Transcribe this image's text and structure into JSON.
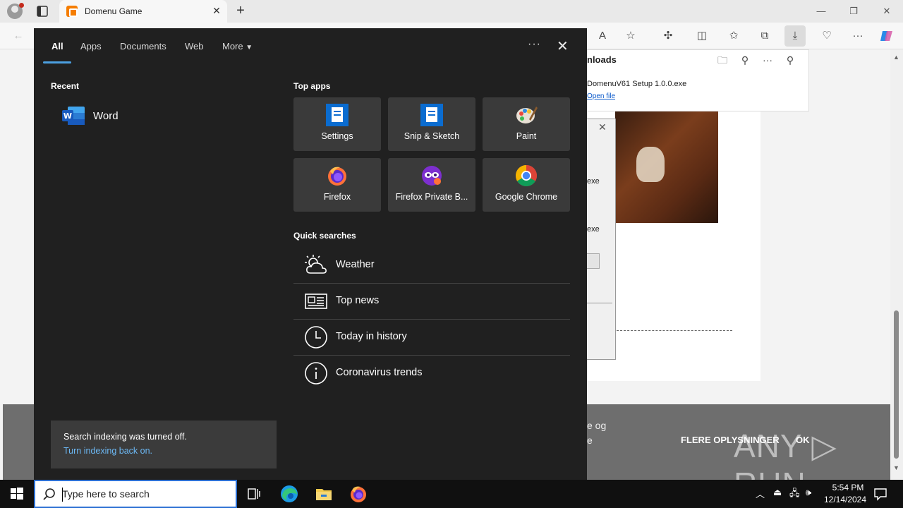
{
  "browser": {
    "tab_title": "Domenu Game",
    "downloads_panel": {
      "title": "nloads",
      "file_name": "DomenuV61 Setup 1.0.0.exe",
      "open_file": "Open file"
    }
  },
  "page": {
    "dialog_text1": "exe",
    "dialog_text2": "exe",
    "cookie_line1": "e og",
    "cookie_line2": "e",
    "cookie_more": "FLERE OPLYSNINGER",
    "cookie_ok": "OK",
    "watermark": "ANY ▷ RUN"
  },
  "search_panel": {
    "tabs": [
      {
        "label": "All"
      },
      {
        "label": "Apps"
      },
      {
        "label": "Documents"
      },
      {
        "label": "Web"
      },
      {
        "label": "More"
      }
    ],
    "more_options": "···",
    "recent_heading": "Recent",
    "recent_items": [
      {
        "label": "Word"
      }
    ],
    "top_apps_heading": "Top apps",
    "top_apps": [
      {
        "label": "Settings"
      },
      {
        "label": "Snip & Sketch"
      },
      {
        "label": "Paint"
      },
      {
        "label": "Firefox"
      },
      {
        "label": "Firefox Private B..."
      },
      {
        "label": "Google Chrome"
      }
    ],
    "quick_searches_heading": "Quick searches",
    "quick_searches": [
      {
        "label": "Weather"
      },
      {
        "label": "Top news"
      },
      {
        "label": "Today in history"
      },
      {
        "label": "Coronavirus trends"
      }
    ],
    "indexing_notice": {
      "message": "Search indexing was turned off.",
      "link": "Turn indexing back on."
    }
  },
  "taskbar": {
    "search_placeholder": "Type here to search",
    "time": "5:54 PM",
    "date": "12/14/2024"
  },
  "colors": {
    "panel_bg": "#202020",
    "tile_bg": "#3a3a3a",
    "accent": "#4ca0e0",
    "link": "#6cb8f4"
  }
}
